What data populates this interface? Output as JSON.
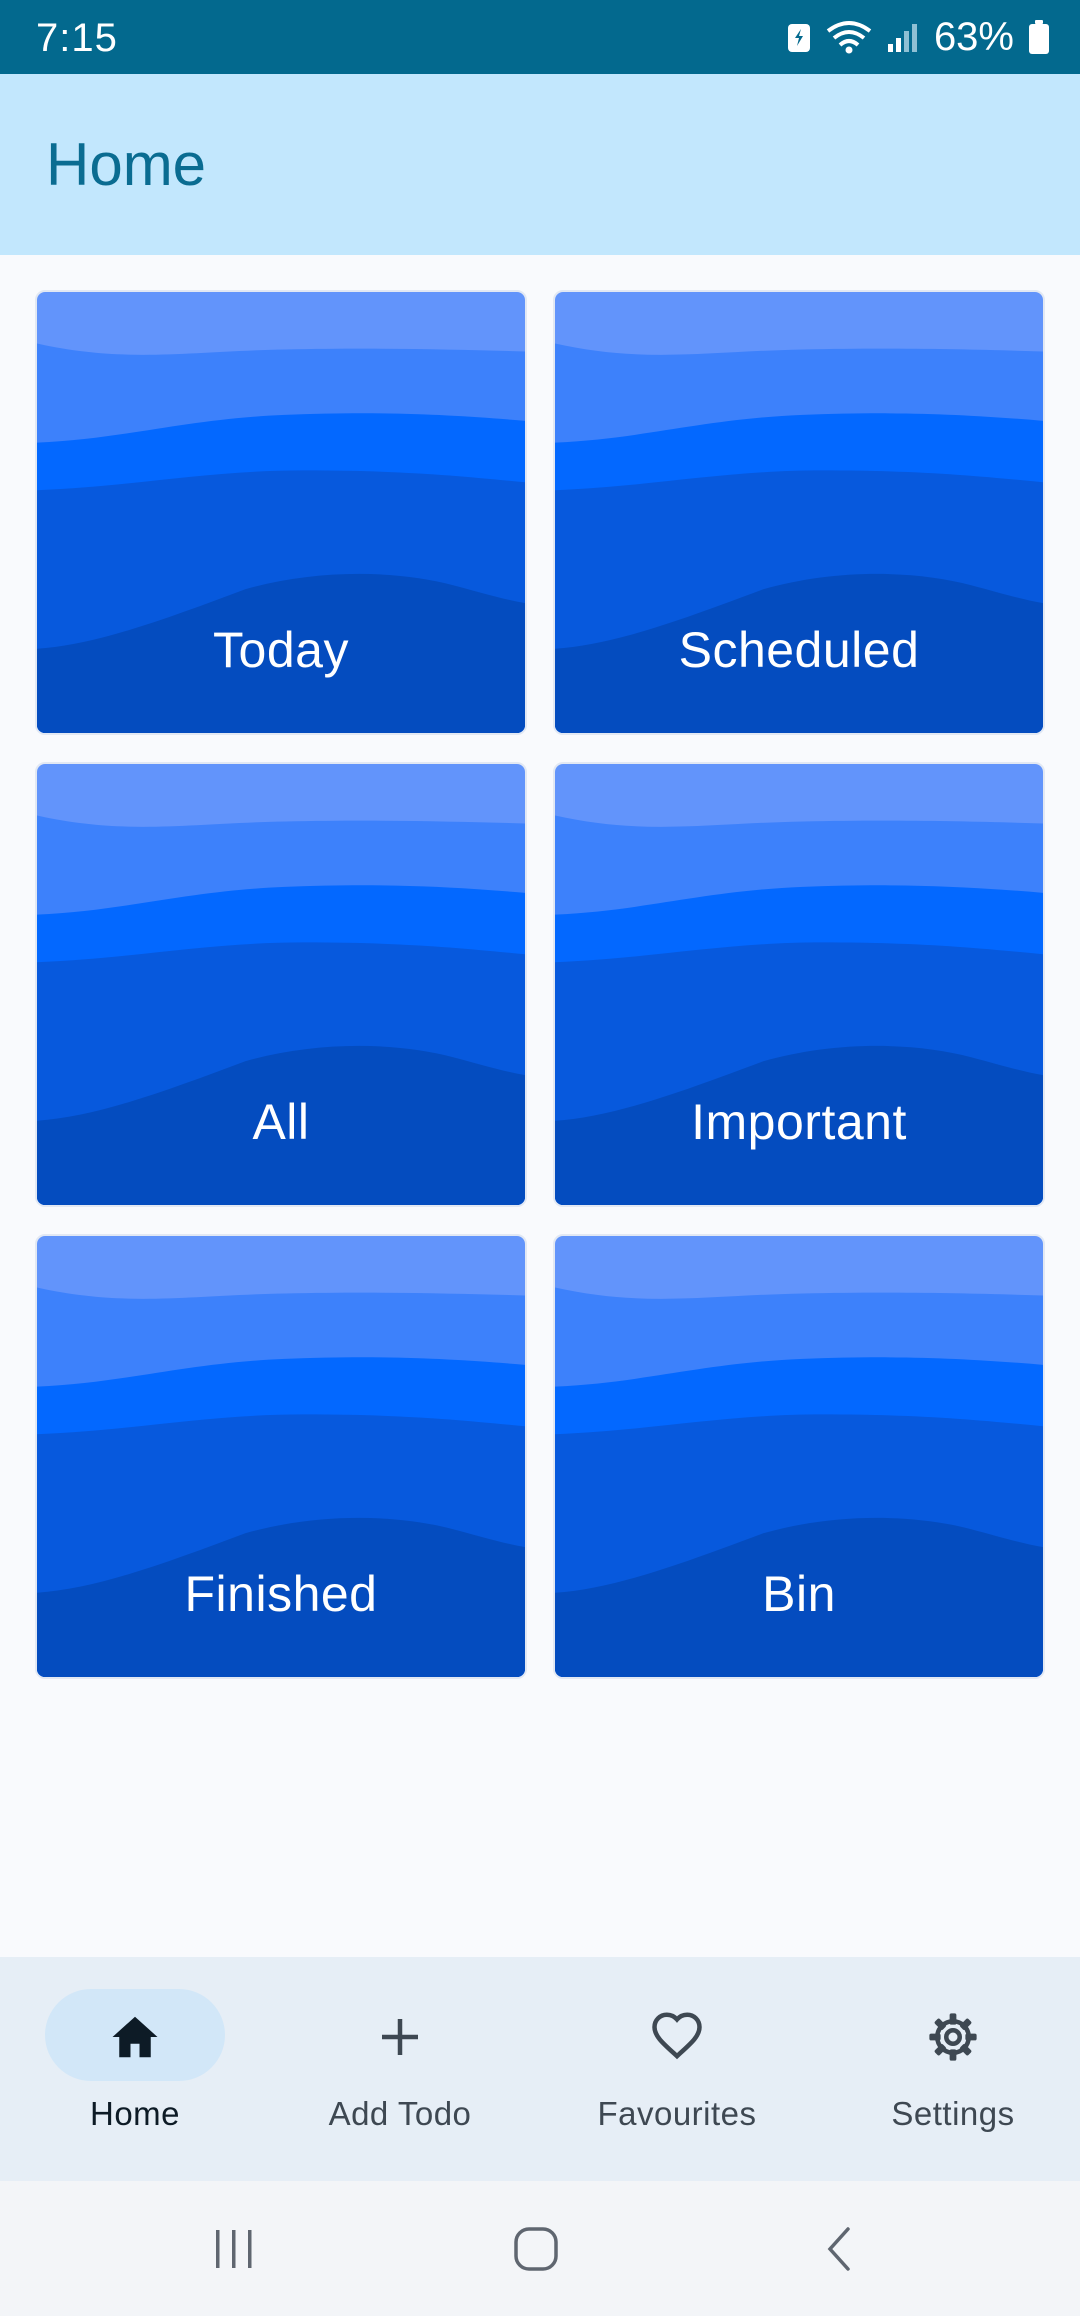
{
  "status_bar": {
    "time": "7:15",
    "battery": "63%",
    "icons": [
      "battery-saver-icon",
      "wifi-icon",
      "signal-icon",
      "battery-icon"
    ]
  },
  "header": {
    "title": "Home"
  },
  "tiles": [
    {
      "label": "Today"
    },
    {
      "label": "Scheduled"
    },
    {
      "label": "All"
    },
    {
      "label": "Important"
    },
    {
      "label": "Finished"
    },
    {
      "label": "Bin"
    }
  ],
  "bottom_nav": {
    "items": [
      {
        "label": "Home",
        "icon": "home-icon",
        "active": true
      },
      {
        "label": "Add Todo",
        "icon": "plus-icon",
        "active": false
      },
      {
        "label": "Favourites",
        "icon": "heart-icon",
        "active": false
      },
      {
        "label": "Settings",
        "icon": "gear-icon",
        "active": false
      }
    ]
  },
  "system_nav": {
    "buttons": [
      "recents-icon",
      "home-circle-icon",
      "back-icon"
    ]
  },
  "colors": {
    "status_bar": "#03698E",
    "app_bar": "#C2E7FD",
    "title": "#0A6C91",
    "wave_1": "#6294FB",
    "wave_2": "#3D81FB",
    "wave_3": "#0368FF",
    "wave_4": "#0759DD",
    "wave_5": "#044CBF",
    "nav_bg": "#E6EEF6",
    "nav_active_pill": "#D2E7F8"
  }
}
